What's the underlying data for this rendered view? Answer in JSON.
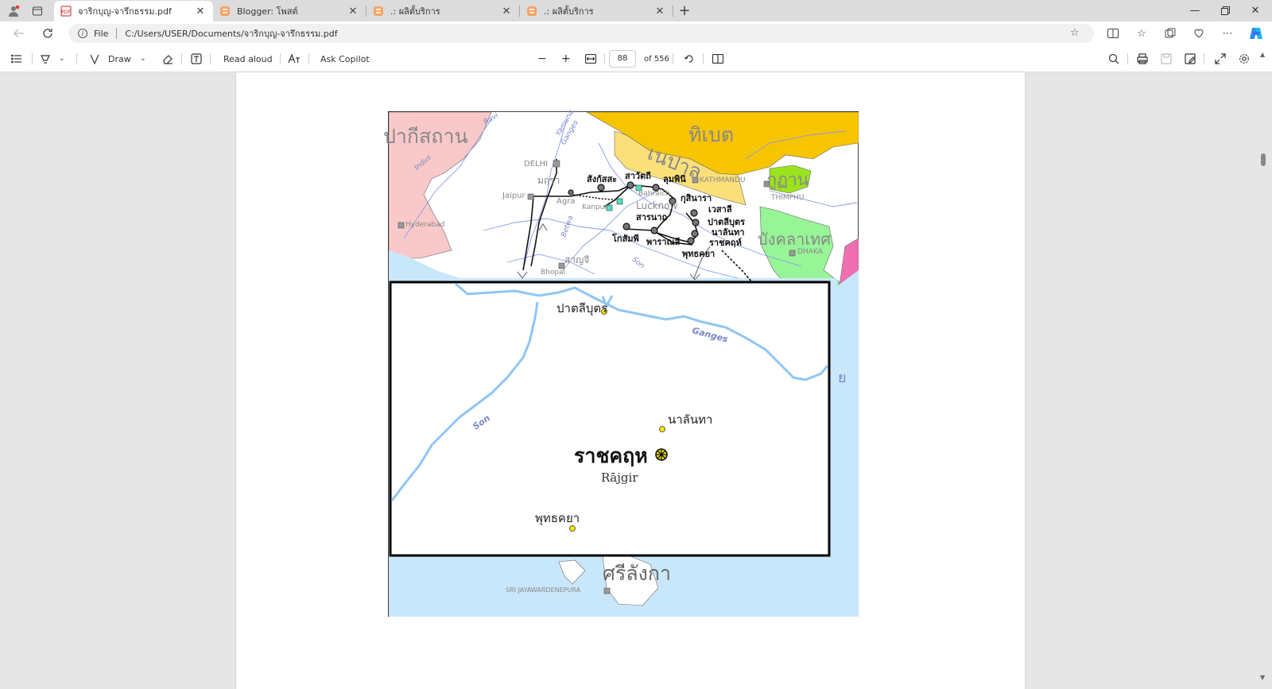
{
  "browser": {
    "tabs": [
      {
        "title": "จาริกบุญ-จารึกธรรม.pdf",
        "active": true
      },
      {
        "title": "Blogger: โพสต์",
        "active": false
      },
      {
        "title": ".: ผลิตั้บริการ",
        "active": false
      },
      {
        "title": ".: ผลิตั้บริการ",
        "active": false
      }
    ],
    "address": {
      "scheme_label": "File",
      "url": "C:/Users/USER/Documents/จาริกบุญ-จารึกธรรม.pdf"
    }
  },
  "pdf_toolbar": {
    "draw_label": "Draw",
    "read_aloud_label": "Read aloud",
    "ask_copilot_label": "Ask Copilot",
    "page_current": "88",
    "page_total": "of 556"
  },
  "map": {
    "countries": {
      "pakistan": "ปากีสถาน",
      "tibet": "ทิเบต",
      "nepal": "เนปาล",
      "bhutan": "ภูฏาน",
      "bangladesh": "บังคลาเทศ",
      "srilanka": "ศรีลังกา"
    },
    "cities": {
      "delhi": "DELHI",
      "jaipur": "Jaipur",
      "agra": "Agra",
      "hyderabad": "Hyderabad",
      "kathmandu": "KATHMANDU",
      "thimphu": "THIMPHU",
      "dhaka": "DHAKA",
      "kanpur": "Kanpur",
      "lucknow": "Lucknow",
      "bahraich": "Bahraich",
      "bhopal": "Bhopal",
      "colombo": "SRI JAYAWARDENEPURA"
    },
    "sites": {
      "mathura": "มถุรา",
      "sankassa": "สังกัสสะ",
      "savatthi": "สาวัตถี",
      "lumbini": "ลุมพินี",
      "kusinara": "กุสินารา",
      "vesali": "เวสาลี",
      "pataliputra": "ปาตลีบุตร",
      "nalanda": "นาลันทา",
      "rajgir": "ราชคฤห์",
      "bodhgaya": "พุทธคยา",
      "sarnath": "สารนาถ",
      "kosambi": "โกสัมพี",
      "varanasi": "พาราณสี",
      "sanchi": "สาญจี"
    },
    "rivers": {
      "indus": "Indus",
      "yamuna": "Yamuna",
      "ganges": "Ganges",
      "betwa": "Betwa",
      "son": "Son",
      "ravi": "Ravi"
    },
    "inset": {
      "pataliputra": "ปาตลีบุตร",
      "ganges": "Ganges",
      "son": "Son",
      "nalanda": "นาลันทา",
      "rajgir_th": "ราชคฤห",
      "rajgir_en": "Rājgir",
      "bodhgaya": "พุทธคยา",
      "edge_label": "ย"
    }
  },
  "colors": {
    "pakistan": "#f9c9c9",
    "tibet": "#f7c400",
    "nepal": "#fbe07a",
    "bhutan": "#9be31f",
    "bangladesh": "#97f597",
    "sea": "#c9e7fb",
    "river": "#8fc6f4"
  }
}
